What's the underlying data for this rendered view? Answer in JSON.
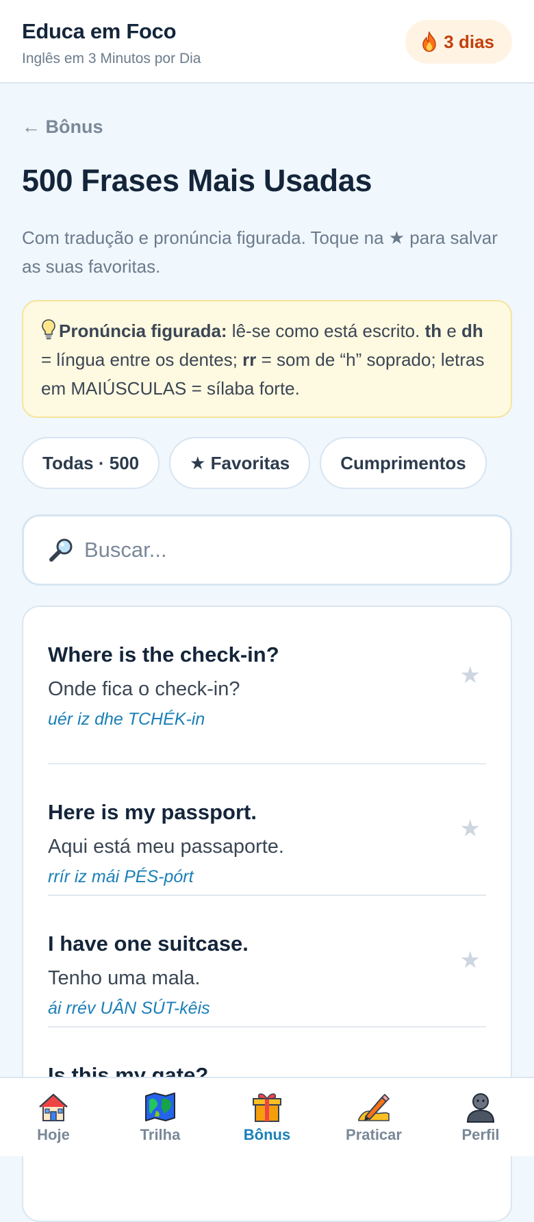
{
  "header": {
    "brand": "Educa em Foco",
    "tagline": "Inglês em 3 Minutos por Dia",
    "streak": "3 dias",
    "streak_icon": "fire-icon"
  },
  "back_link": "← Bônus",
  "page_title": "500 Frases Mais Usadas",
  "subtitle": "Com tradução e pronúncia figurada. Toque na ★ para salvar as suas favoritas.",
  "tip": {
    "icon": "lightbulb-icon",
    "label": "Pronúncia figurada:",
    "text_1": " lê-se como está escrito. ",
    "th": "th",
    "text_2": " e ",
    "dh": "dh",
    "text_3": " = língua entre os dentes; ",
    "rr": "rr",
    "text_4": " = som de “h” soprado; letras em MAIÚSCULAS = sílaba forte."
  },
  "chips": [
    {
      "label": "Todas · 500"
    },
    {
      "label": "★ Favoritas"
    },
    {
      "label": "Cumprimentos"
    }
  ],
  "search": {
    "placeholder": "Buscar...",
    "value": ""
  },
  "phrases": [
    {
      "en": "Where is the check-in?",
      "pt": "Onde fica o check-in?",
      "pron": "uér iz dhe TCHÉK-in",
      "star": "★"
    },
    {
      "en": "Here is my passport.",
      "pt": "Aqui está meu passaporte.",
      "pron": "rrír iz mái PÉS-pórt",
      "star": "★"
    },
    {
      "en": "I have one suitcase.",
      "pt": "Tenho uma mala.",
      "pron": "ái rrév UÂN SÚT-kêis",
      "star": "★"
    },
    {
      "en": "Is this my gate?",
      "pt": "",
      "pron": "",
      "star": "★"
    }
  ],
  "nav": [
    {
      "label": "Hoje",
      "icon": "house-icon"
    },
    {
      "label": "Trilha",
      "icon": "map-icon"
    },
    {
      "label": "Bônus",
      "icon": "gift-icon",
      "active": true
    },
    {
      "label": "Praticar",
      "icon": "pencil-icon"
    },
    {
      "label": "Perfil",
      "icon": "person-icon"
    }
  ],
  "colors": {
    "accent": "#1a7fb7",
    "streak": "#c2410c",
    "background": "#f0f7fd"
  }
}
